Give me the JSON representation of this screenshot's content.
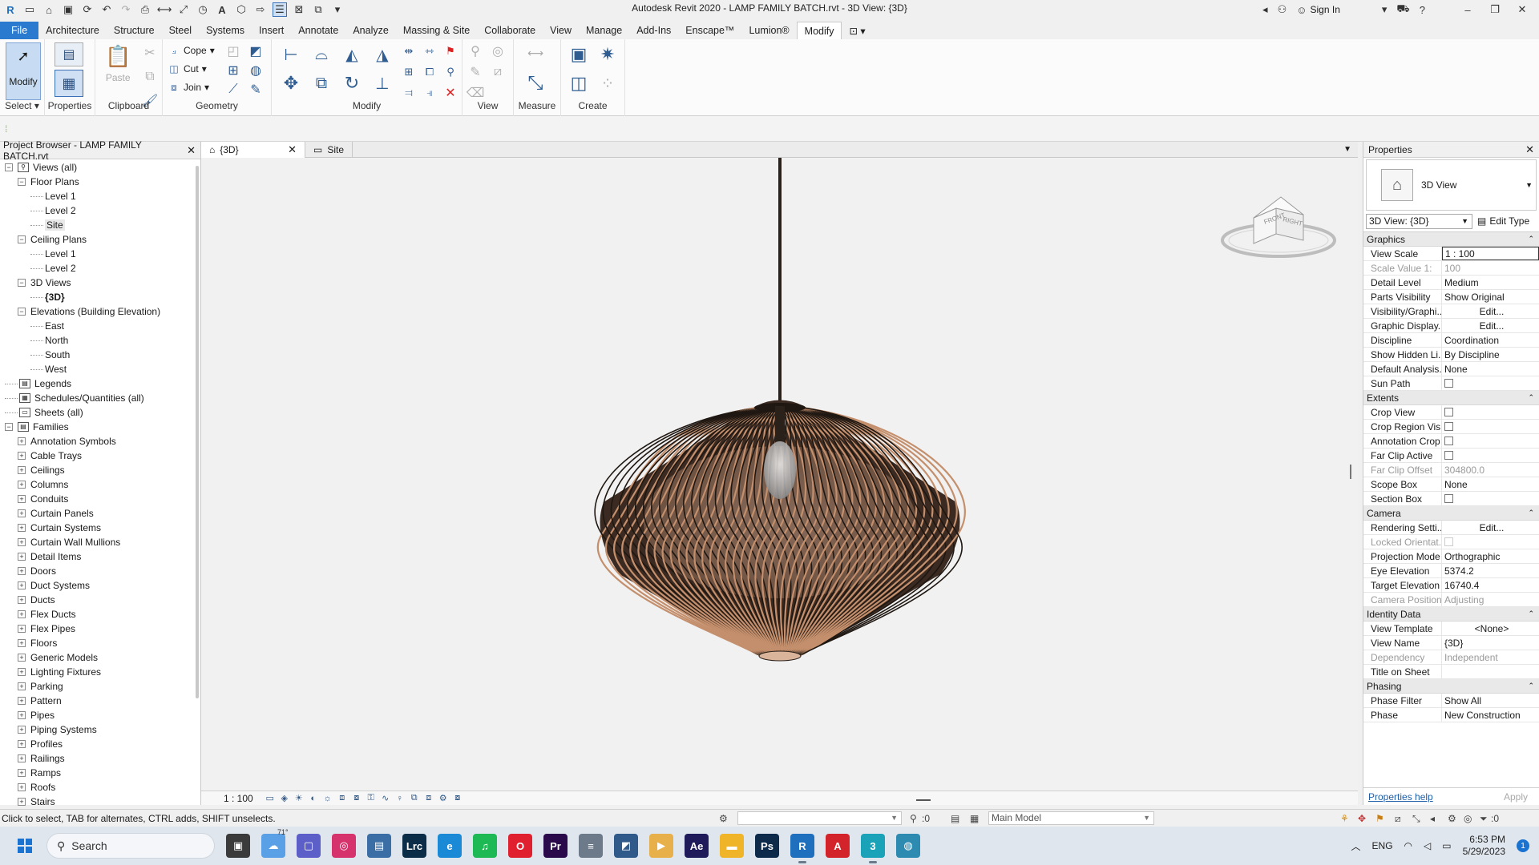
{
  "window": {
    "title": "Autodesk Revit 2020 - LAMP FAMILY BATCH.rvt - 3D View: {3D}",
    "sign_in": "Sign In"
  },
  "ribbon": {
    "tabs": [
      "File",
      "Architecture",
      "Structure",
      "Steel",
      "Systems",
      "Insert",
      "Annotate",
      "Analyze",
      "Massing & Site",
      "Collaborate",
      "View",
      "Manage",
      "Add-Ins",
      "Enscape™",
      "Lumion®",
      "Modify"
    ],
    "active_tab": "Modify",
    "panels": {
      "select": "Select",
      "properties": "Properties",
      "clipboard": "Clipboard",
      "geometry": "Geometry",
      "modify": "Modify",
      "view": "View",
      "measure": "Measure",
      "create": "Create"
    },
    "buttons": {
      "modify": "Modify",
      "paste": "Paste",
      "cope": "Cope",
      "cut": "Cut",
      "join": "Join"
    }
  },
  "project_browser": {
    "title": "Project Browser - LAMP FAMILY BATCH.rvt",
    "views_root": "Views (all)",
    "floor_plans": "Floor Plans",
    "floor_plan_items": [
      "Level 1",
      "Level 2",
      "Site"
    ],
    "ceiling_plans": "Ceiling Plans",
    "ceiling_plan_items": [
      "Level 1",
      "Level 2"
    ],
    "views_3d": "3D Views",
    "views_3d_items": [
      "{3D}"
    ],
    "elevations": "Elevations (Building Elevation)",
    "elevation_items": [
      "East",
      "North",
      "South",
      "West"
    ],
    "legends": "Legends",
    "schedules": "Schedules/Quantities (all)",
    "sheets": "Sheets (all)",
    "families": "Families",
    "family_items": [
      "Annotation Symbols",
      "Cable Trays",
      "Ceilings",
      "Columns",
      "Conduits",
      "Curtain Panels",
      "Curtain Systems",
      "Curtain Wall Mullions",
      "Detail Items",
      "Doors",
      "Duct Systems",
      "Ducts",
      "Flex Ducts",
      "Flex Pipes",
      "Floors",
      "Generic Models",
      "Lighting Fixtures",
      "Parking",
      "Pattern",
      "Pipes",
      "Piping Systems",
      "Profiles",
      "Railings",
      "Ramps",
      "Roofs",
      "Stairs"
    ]
  },
  "view_tabs": [
    {
      "label": "{3D}",
      "active": true
    },
    {
      "label": "Site",
      "active": false
    }
  ],
  "view_control": {
    "scale": "1 : 100"
  },
  "viewcube": {
    "front": "FRONT",
    "right": "RIGHT"
  },
  "properties": {
    "title": "Properties",
    "type_name": "3D View",
    "instance_selector": "3D View: {3D}",
    "edit_type": "Edit Type",
    "sections": [
      {
        "name": "Graphics",
        "rows": [
          {
            "k": "View Scale",
            "v": "1 : 100",
            "style": "boxed"
          },
          {
            "k": "Scale Value    1:",
            "v": "100",
            "ro": true
          },
          {
            "k": "Detail Level",
            "v": "Medium"
          },
          {
            "k": "Parts Visibility",
            "v": "Show Original"
          },
          {
            "k": "Visibility/Graphi...",
            "v": "Edit...",
            "style": "btn"
          },
          {
            "k": "Graphic Display...",
            "v": "Edit...",
            "style": "btn"
          },
          {
            "k": "Discipline",
            "v": "Coordination"
          },
          {
            "k": "Show Hidden Li...",
            "v": "By Discipline"
          },
          {
            "k": "Default Analysis...",
            "v": "None"
          },
          {
            "k": "Sun Path",
            "v": "",
            "style": "cb"
          }
        ]
      },
      {
        "name": "Extents",
        "rows": [
          {
            "k": "Crop View",
            "v": "",
            "style": "cb"
          },
          {
            "k": "Crop Region Vis...",
            "v": "",
            "style": "cb"
          },
          {
            "k": "Annotation Crop",
            "v": "",
            "style": "cb"
          },
          {
            "k": "Far Clip Active",
            "v": "",
            "style": "cb"
          },
          {
            "k": "Far Clip Offset",
            "v": "304800.0",
            "ro": true
          },
          {
            "k": "Scope Box",
            "v": "None"
          },
          {
            "k": "Section Box",
            "v": "",
            "style": "cb"
          }
        ]
      },
      {
        "name": "Camera",
        "rows": [
          {
            "k": "Rendering Setti...",
            "v": "Edit...",
            "style": "btn"
          },
          {
            "k": "Locked Orientat...",
            "v": "",
            "style": "cbdis",
            "ro": true
          },
          {
            "k": "Projection Mode",
            "v": "Orthographic"
          },
          {
            "k": "Eye Elevation",
            "v": "5374.2"
          },
          {
            "k": "Target Elevation",
            "v": "16740.4"
          },
          {
            "k": "Camera Position",
            "v": "Adjusting",
            "ro": true
          }
        ]
      },
      {
        "name": "Identity Data",
        "rows": [
          {
            "k": "View Template",
            "v": "<None>",
            "style": "btn"
          },
          {
            "k": "View Name",
            "v": "{3D}"
          },
          {
            "k": "Dependency",
            "v": "Independent",
            "ro": true
          },
          {
            "k": "Title on Sheet",
            "v": ""
          }
        ]
      },
      {
        "name": "Phasing",
        "rows": [
          {
            "k": "Phase Filter",
            "v": "Show All"
          },
          {
            "k": "Phase",
            "v": "New Construction"
          }
        ]
      }
    ],
    "help_link": "Properties help",
    "apply": "Apply"
  },
  "status": {
    "message": "Click to select, TAB for alternates, CTRL adds, SHIFT unselects.",
    "workset_count": ":0",
    "model": "Main Model",
    "filter_count": ":0"
  },
  "taskbar": {
    "search_placeholder": "Search",
    "weather": "71°",
    "language": "ENG",
    "time": "6:53 PM",
    "date": "5/29/2023",
    "notifications": "1",
    "apps": [
      {
        "name": "task-view",
        "label": "▣",
        "color": "#3b3b3b"
      },
      {
        "name": "weather-widget",
        "label": "☁",
        "color": "#5aa0e6"
      },
      {
        "name": "teams",
        "label": "▢",
        "color": "#5b5fc7"
      },
      {
        "name": "instagram",
        "label": "◎",
        "color": "#d6336c"
      },
      {
        "name": "chart-app",
        "label": "▤",
        "color": "#3a6ea5"
      },
      {
        "name": "lightroom-classic",
        "label": "Lrc",
        "color": "#0c2d48"
      },
      {
        "name": "edge",
        "label": "e",
        "color": "#1b8ad6"
      },
      {
        "name": "spotify",
        "label": "♫",
        "color": "#1db954"
      },
      {
        "name": "opera",
        "label": "O",
        "color": "#e0202e"
      },
      {
        "name": "premiere",
        "label": "Pr",
        "color": "#2a0a4a"
      },
      {
        "name": "hardware-app",
        "label": "≡",
        "color": "#6c7a89"
      },
      {
        "name": "photo-app",
        "label": "◩",
        "color": "#2f5a8a"
      },
      {
        "name": "video-app",
        "label": "▶",
        "color": "#e8b04a"
      },
      {
        "name": "after-effects",
        "label": "Ae",
        "color": "#1f1a5a"
      },
      {
        "name": "file-explorer",
        "label": "▬",
        "color": "#f0b429"
      },
      {
        "name": "photoshop",
        "label": "Ps",
        "color": "#0d2a4a"
      },
      {
        "name": "revit",
        "label": "R",
        "color": "#1f6fbf",
        "running": true
      },
      {
        "name": "autocad",
        "label": "A",
        "color": "#d4242b"
      },
      {
        "name": "3ds-max",
        "label": "3",
        "color": "#1aa3b8",
        "running": true
      },
      {
        "name": "globe-app",
        "label": "◍",
        "color": "#2d8ab0"
      }
    ]
  }
}
